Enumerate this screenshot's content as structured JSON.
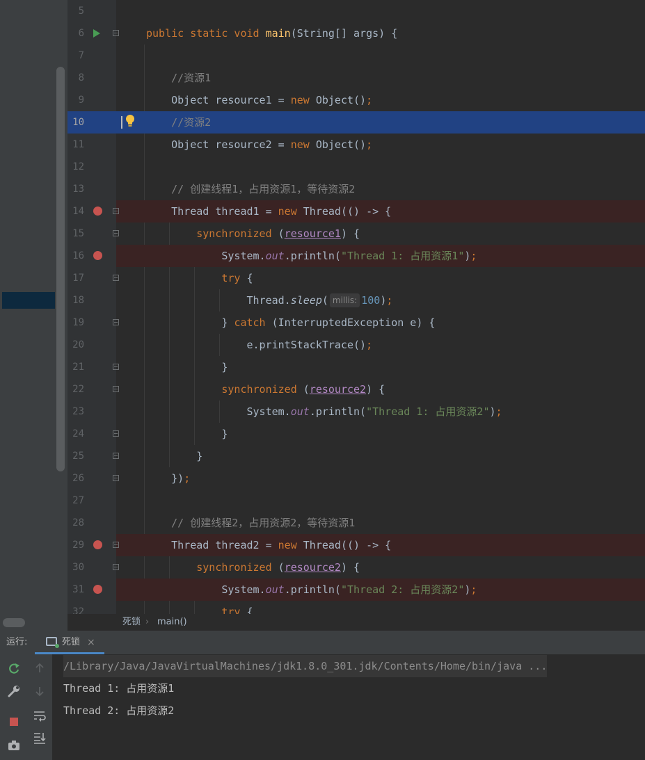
{
  "editor": {
    "lines": [
      {
        "num": "5",
        "code": ""
      },
      {
        "num": "6",
        "code": "public static void main(String[] args) {"
      },
      {
        "num": "7",
        "code": ""
      },
      {
        "num": "8",
        "code": "    //资源1"
      },
      {
        "num": "9",
        "code": "    Object resource1 = new Object();"
      },
      {
        "num": "10",
        "code": "    //资源2"
      },
      {
        "num": "11",
        "code": "    Object resource2 = new Object();"
      },
      {
        "num": "12",
        "code": ""
      },
      {
        "num": "13",
        "code": "    // 创建线程1，占用资源1，等待资源2"
      },
      {
        "num": "14",
        "code": "    Thread thread1 = new Thread(() -> {"
      },
      {
        "num": "15",
        "code": "        synchronized (resource1) {"
      },
      {
        "num": "16",
        "code": "            System.out.println(\"Thread 1: 占用资源1\");"
      },
      {
        "num": "17",
        "code": "            try {"
      },
      {
        "num": "18",
        "code": "                Thread.sleep( millis: 100);"
      },
      {
        "num": "19",
        "code": "            } catch (InterruptedException e) {"
      },
      {
        "num": "20",
        "code": "                e.printStackTrace();"
      },
      {
        "num": "21",
        "code": "            }"
      },
      {
        "num": "22",
        "code": "            synchronized (resource2) {"
      },
      {
        "num": "23",
        "code": "                System.out.println(\"Thread 1: 占用资源2\");"
      },
      {
        "num": "24",
        "code": "            }"
      },
      {
        "num": "25",
        "code": "        }"
      },
      {
        "num": "26",
        "code": "    });"
      },
      {
        "num": "27",
        "code": ""
      },
      {
        "num": "28",
        "code": "    // 创建线程2，占用资源2，等待资源1"
      },
      {
        "num": "29",
        "code": "    Thread thread2 = new Thread(() -> {"
      },
      {
        "num": "30",
        "code": "        synchronized (resource2) {"
      },
      {
        "num": "31",
        "code": "            System.out.println(\"Thread 2: 占用资源2\");"
      },
      {
        "num": "32",
        "code": "            try {"
      }
    ],
    "current_line": "10",
    "breakpoint_lines": [
      "14",
      "16",
      "29",
      "31"
    ],
    "run_gutter_line": "6"
  },
  "breadcrumb": {
    "file": "死锁",
    "separator": "›",
    "method": "main()"
  },
  "run_panel": {
    "label": "运行:",
    "tab_label": "死锁",
    "tab_close": "×",
    "console_lines": [
      "/Library/Java/JavaVirtualMachines/jdk1.8.0_301.jdk/Contents/Home/bin/java ...",
      "Thread 1: 占用资源1",
      "Thread 2: 占用资源2"
    ]
  },
  "toolbar_icons": [
    "rerun-icon",
    "up-arrow-icon",
    "wrench-icon",
    "down-arrow-icon",
    "stop-icon",
    "soft-wrap-icon",
    "camera-icon",
    "scroll-to-end-icon"
  ],
  "colors": {
    "editor_bg": "#2b2b2b",
    "current_line": "#214283",
    "breakpoint": "#c75450",
    "keyword": "#cc7832",
    "string": "#6a8759",
    "number": "#6897bb",
    "comment": "#808080",
    "method": "#ffc66d"
  }
}
